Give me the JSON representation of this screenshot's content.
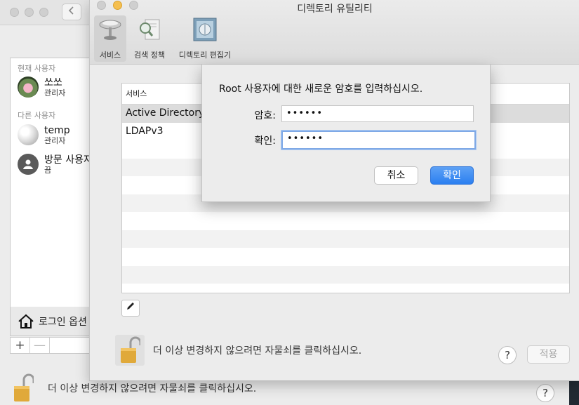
{
  "background_window": {
    "sidebar": {
      "current_header": "현재 사용자",
      "other_header": "다른 사용자",
      "users": [
        {
          "name": "쏘쏘",
          "role": "관리자"
        },
        {
          "name": "temp",
          "role": "관리자"
        },
        {
          "name": "방문 사용자",
          "role": "끔"
        }
      ]
    },
    "login_options_label": "로그인 옵션",
    "plus_label": "+",
    "minus_label": "—",
    "lock_text": "더 이상 변경하지 않으려면 자물쇠를 클릭하십시오.",
    "help_label": "?"
  },
  "directory_utility": {
    "title": "디렉토리 유틸리티",
    "toolbar": [
      {
        "label": "서비스",
        "icon": "services-icon"
      },
      {
        "label": "검색 정책",
        "icon": "search-policy-icon"
      },
      {
        "label": "디렉토리 편집기",
        "icon": "directory-editor-icon"
      }
    ],
    "table": {
      "header": "서비스",
      "rows": [
        "Active Directory",
        "LDAPv3"
      ]
    },
    "lock_text": "더 이상 변경하지 않으려면 자물쇠를 클릭하십시오.",
    "help_label": "?",
    "apply_label": "적용"
  },
  "sheet": {
    "message": "Root 사용자에 대한 새로운 암호를 입력하십시오.",
    "password_label": "암호:",
    "password_value": "••••••",
    "confirm_label": "확인:",
    "confirm_value": "••••••",
    "cancel_label": "취소",
    "ok_label": "확인"
  },
  "colors": {
    "accent": "#2b7ff0",
    "focus_ring": "#7fa9e6",
    "window_bg": "#ececec"
  }
}
